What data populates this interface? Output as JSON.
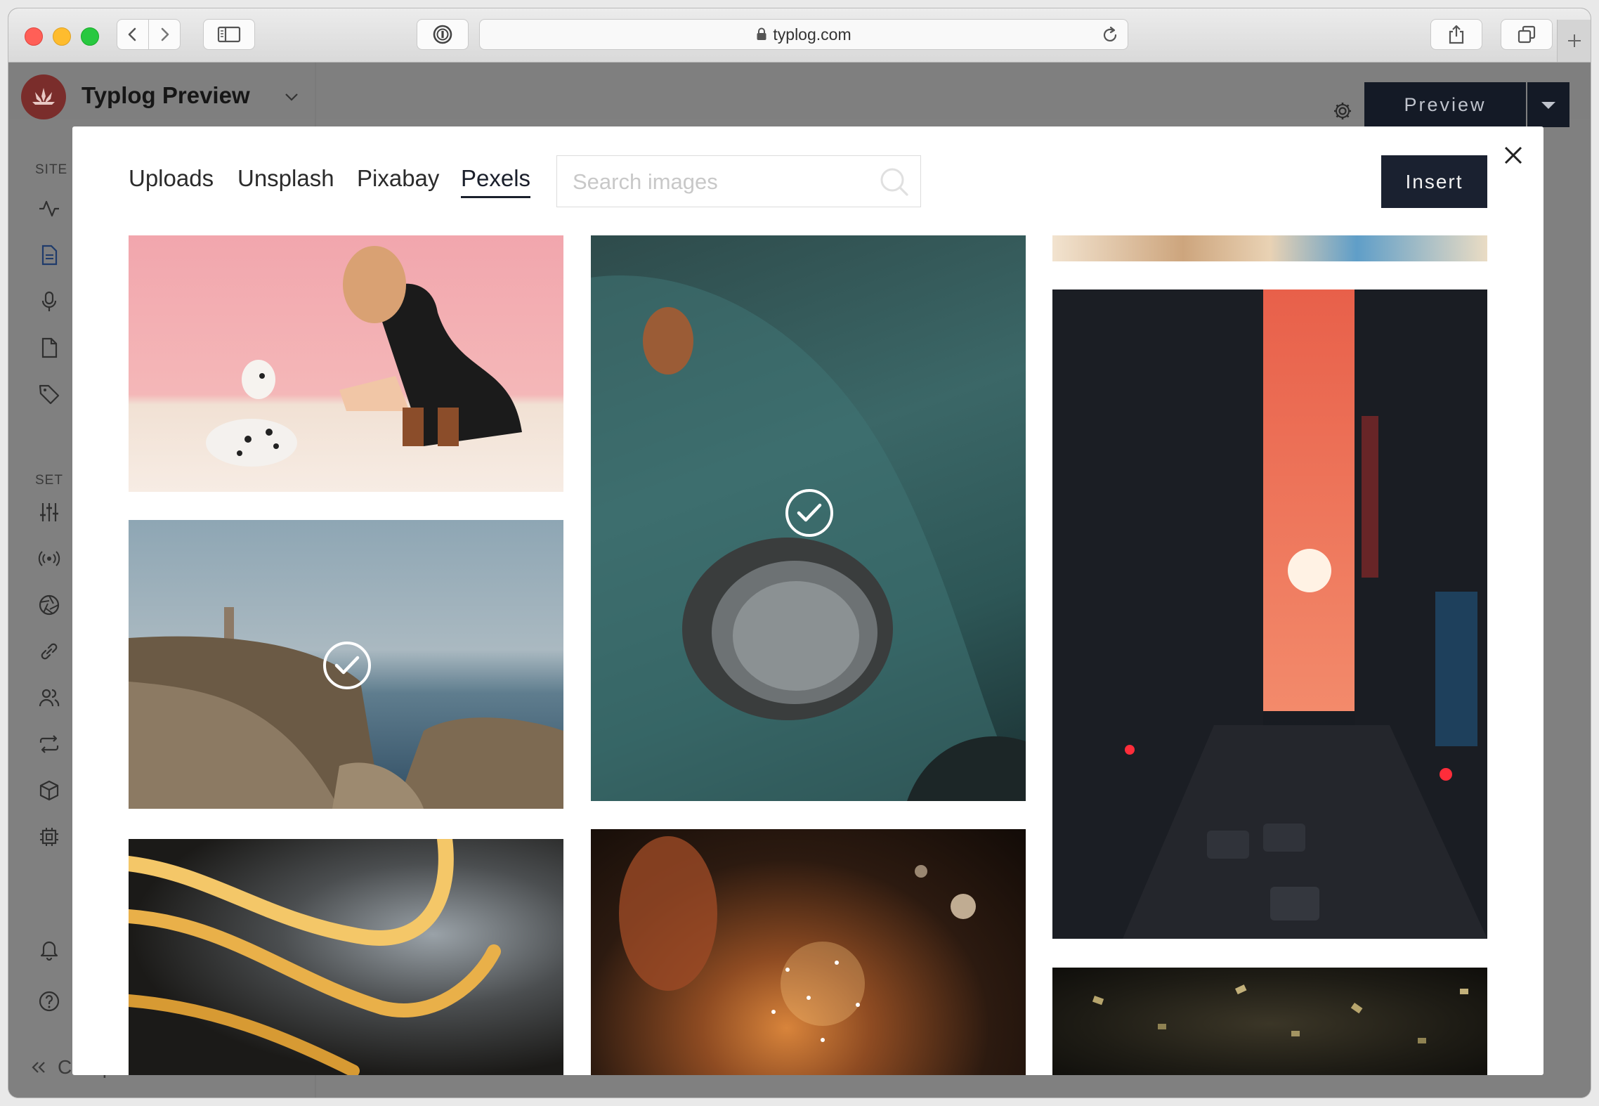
{
  "browser": {
    "url": "typlog.com"
  },
  "app": {
    "site_title": "Typlog Preview",
    "sidebar": {
      "section_site": "SITE",
      "section_settings": "SET",
      "collapse_label": "Collapse"
    },
    "preview_label": "Preview"
  },
  "modal": {
    "tabs": [
      {
        "label": "Uploads",
        "active": false
      },
      {
        "label": "Unsplash",
        "active": false
      },
      {
        "label": "Pixabay",
        "active": false
      },
      {
        "label": "Pexels",
        "active": true
      }
    ],
    "search": {
      "placeholder": "Search images",
      "value": ""
    },
    "insert_label": "Insert",
    "images": [
      {
        "subject": "woman-with-dalmatian",
        "selected": false
      },
      {
        "subject": "lighthouse-coast",
        "selected": true
      },
      {
        "subject": "light-streaks",
        "selected": false
      },
      {
        "subject": "teal-car-headlight",
        "selected": true
      },
      {
        "subject": "sparkler",
        "selected": false
      },
      {
        "subject": "city-sunset-street",
        "selected": false
      },
      {
        "subject": "confetti",
        "selected": false
      }
    ]
  },
  "colors": {
    "accent_dark": "#1a2130",
    "logo_red": "#7a2d2b",
    "close_red": "#ff5f57",
    "minimize_yellow": "#febc2e",
    "zoom_green": "#28c840"
  }
}
